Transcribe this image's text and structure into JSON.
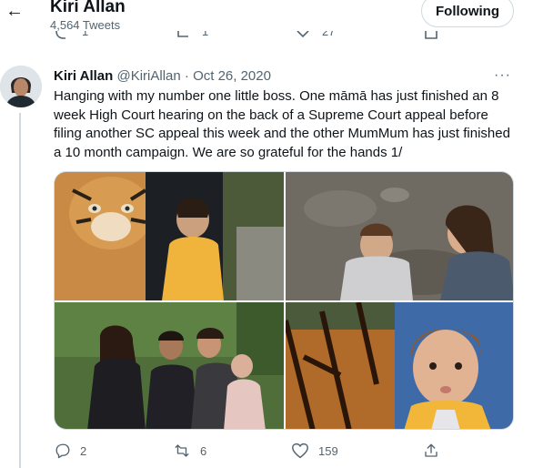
{
  "header": {
    "back_icon": "arrow-left-icon",
    "profile_name": "Kiri Allan",
    "tweet_count": "4,564 Tweets",
    "follow_button": "Following"
  },
  "prev_tweet_actions": {
    "retweets": "1",
    "likes": "27"
  },
  "tweet": {
    "author_name": "Kiri Allan",
    "handle": "@KiriAllan",
    "separator": " · ",
    "date": "Oct 26, 2020",
    "more_icon": "more-horizontal-icon",
    "text": "Hanging with my number one little boss. One māmā has just finished an 8 week High Court hearing on the back of a Supreme Court appeal before filing another SC appeal this week and the other MumMum has just finished a 10 month campaign. We are so grateful for the hands 1/",
    "actions": {
      "reply_count": "2",
      "retweet_count": "6",
      "like_count": "159"
    }
  },
  "colors": {
    "text_primary": "#0f1419",
    "text_secondary": "#536471",
    "border": "#cfd9de"
  }
}
